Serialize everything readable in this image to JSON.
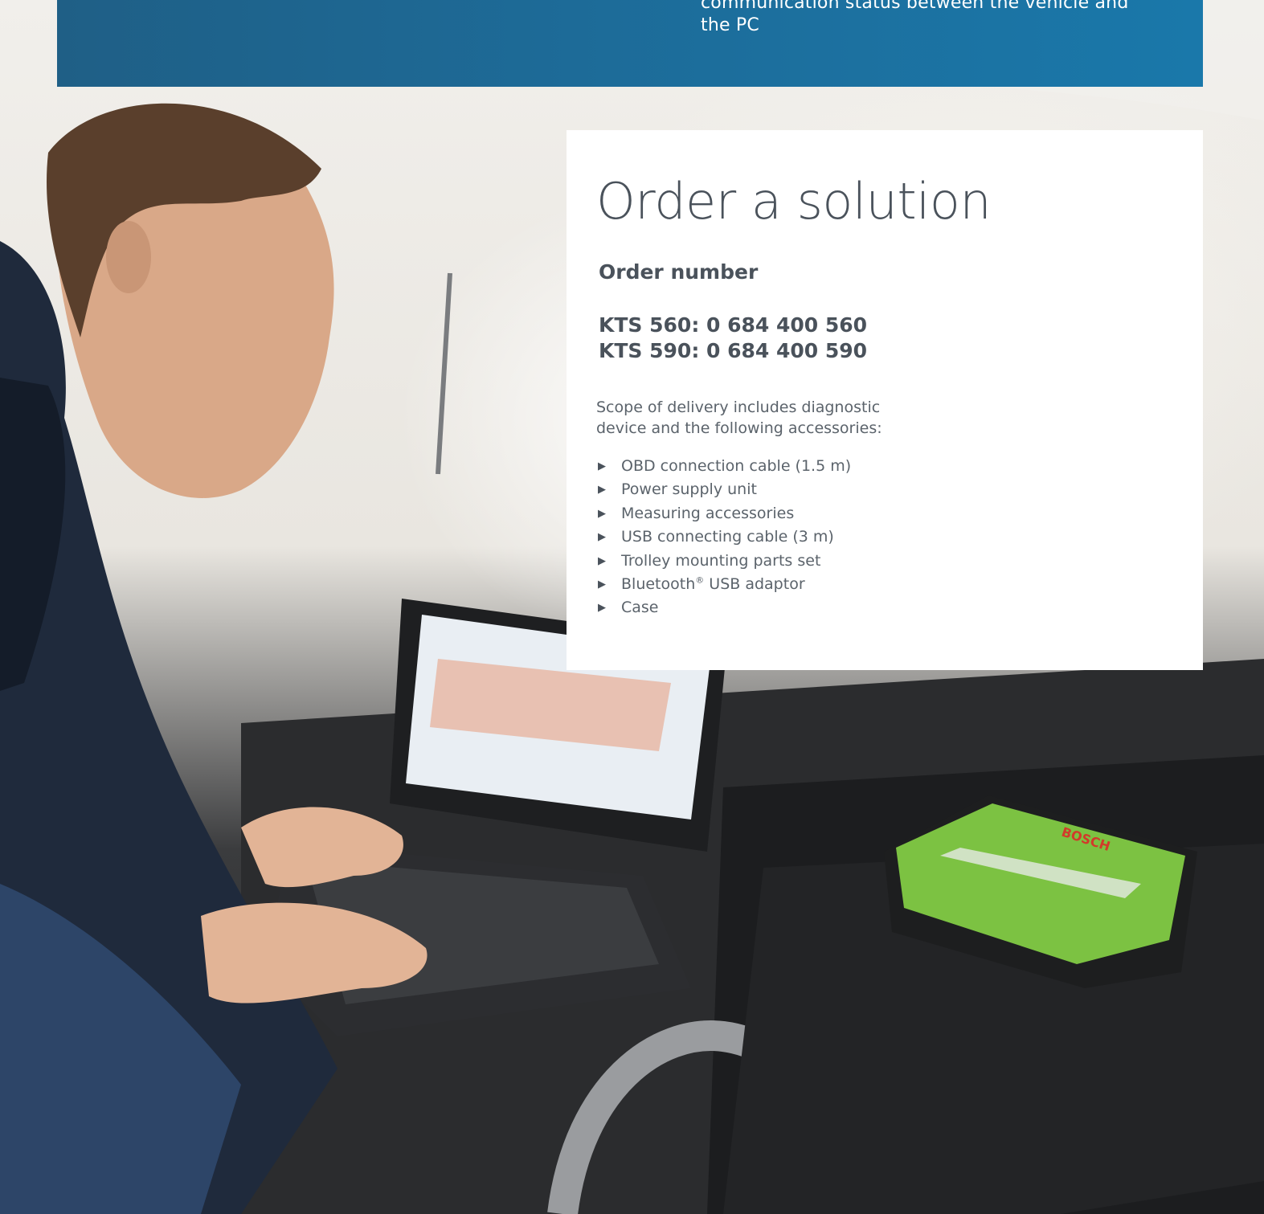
{
  "header": {
    "lines": [
      "communication status between the vehicle and",
      "the PC"
    ]
  },
  "card": {
    "title": "Order a solution",
    "order_label": "Order number",
    "order_numbers": [
      "KTS 560: 0 684 400 560",
      "KTS 590: 0 684 400 590"
    ],
    "scope_lines": [
      "Scope of delivery includes diagnostic",
      "device and the following accessories:"
    ],
    "accessories": [
      {
        "text": "OBD connection cable (1.5 m)"
      },
      {
        "text": "Power supply unit"
      },
      {
        "text": "Measuring accessories"
      },
      {
        "text": "USB connecting cable (3 m)"
      },
      {
        "text": "Trolley mounting parts set"
      },
      {
        "text": "Bluetooth",
        "sup": "®",
        "after": " USB adaptor"
      },
      {
        "text": "Case"
      }
    ],
    "bullet_glyph": "▶"
  },
  "colors": {
    "header_blue": "#1d6b98",
    "title_gray": "#4a525b",
    "body_gray": "#5b636b",
    "card_bg": "#ffffff",
    "device_green": "#7cc242"
  },
  "photo": {
    "device_brand": "BOSCH",
    "subject": "technician-using-laptop-with-diagnostic-device-image"
  }
}
